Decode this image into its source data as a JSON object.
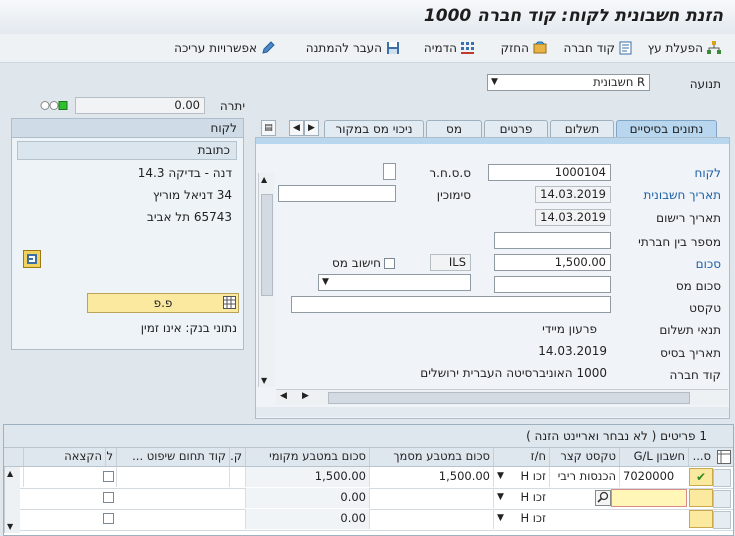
{
  "window": {
    "title": "הזנת חשבונית לקוח: קוד חברה 1000"
  },
  "toolbar": {
    "items": [
      {
        "label": "הפעלת עץ",
        "icon": "tree-icon"
      },
      {
        "label": "קוד חברה",
        "icon": "company-code-icon"
      },
      {
        "label": "החזק",
        "icon": "hold-icon"
      },
      {
        "label": "הדמיה",
        "icon": "simulate-icon"
      },
      {
        "label": "העבר להמתנה",
        "icon": "park-icon"
      },
      {
        "label": "אפשרויות עריכה",
        "icon": "pencil-icon"
      }
    ]
  },
  "header": {
    "transaction_label": "תנועה",
    "transaction_value": "R חשבונית",
    "balance_label": "יתרה",
    "balance_value": "0.00"
  },
  "customer_panel": {
    "title": "לקוח",
    "address_title": "כתובת",
    "address_lines": [
      "דנה - בדיקה 14.3",
      "34 דניאל מוריץ",
      "65743 תל אביב"
    ],
    "pp_button": "פ.פ",
    "bank_data": "נתוני בנק: אינו זמין"
  },
  "tabs": {
    "items": [
      "נתונים בסיסיים",
      "תשלום",
      "פרטים",
      "מס",
      "ניכוי מס במקור"
    ],
    "active_index": 0
  },
  "form": {
    "customer_label": "לקוח",
    "customer_value": "1000104",
    "tax_id_label": "ס.ס.ח.ר",
    "invoice_date_label": "תאריך חשבונית",
    "invoice_date_value": "14.03.2019",
    "reference_label": "סימוכין",
    "posting_date_label": "תאריך רישום",
    "posting_date_value": "14.03.2019",
    "intercompany_label": "מספר בין חברתי",
    "amount_label": "סכום",
    "amount_value": "1,500.00",
    "currency_value": "ILS",
    "calc_tax_label": "חישוב מס",
    "tax_amount_label": "סכום מס",
    "text_label": "טקסט",
    "payment_terms_label": "תנאי תשלום",
    "payment_terms_value": "פרעון מיידי",
    "baseline_date_label": "תאריך בסיס",
    "baseline_date_value": "14.03.2019",
    "company_code_label": "קוד חברה",
    "company_code_value": "1000 האוניברסיטה העברית ירושלים"
  },
  "items_table": {
    "title": "1 פריטים ( לא נבחר ואריינט הזנה )",
    "columns": [
      "ס...",
      "חשבון G/L",
      "טקסט קצר",
      "ח/ז",
      "סכום במטבע מסמך",
      "סכום במטבע מקומי",
      "ק...",
      "קוד תחום שיפוט ...",
      "ל",
      "הקצאה"
    ],
    "rows": [
      {
        "gl": "7020000",
        "text": "הכנסות ריבי",
        "dc": "H זכו",
        "doc_amount": "1,500.00",
        "local_amount": "1,500.00"
      },
      {
        "gl": "",
        "text": "",
        "dc": "H זכו",
        "doc_amount": "",
        "local_amount": "0.00"
      },
      {
        "gl": "",
        "text": "",
        "dc": "H זכו",
        "doc_amount": "",
        "local_amount": "0.00"
      }
    ]
  },
  "colors": {
    "accent_blue": "#1d5fa6",
    "active_tab": "#b8d6ee",
    "button_yellow": "#fbe9a0",
    "ok_green": "#3a9a2a"
  }
}
